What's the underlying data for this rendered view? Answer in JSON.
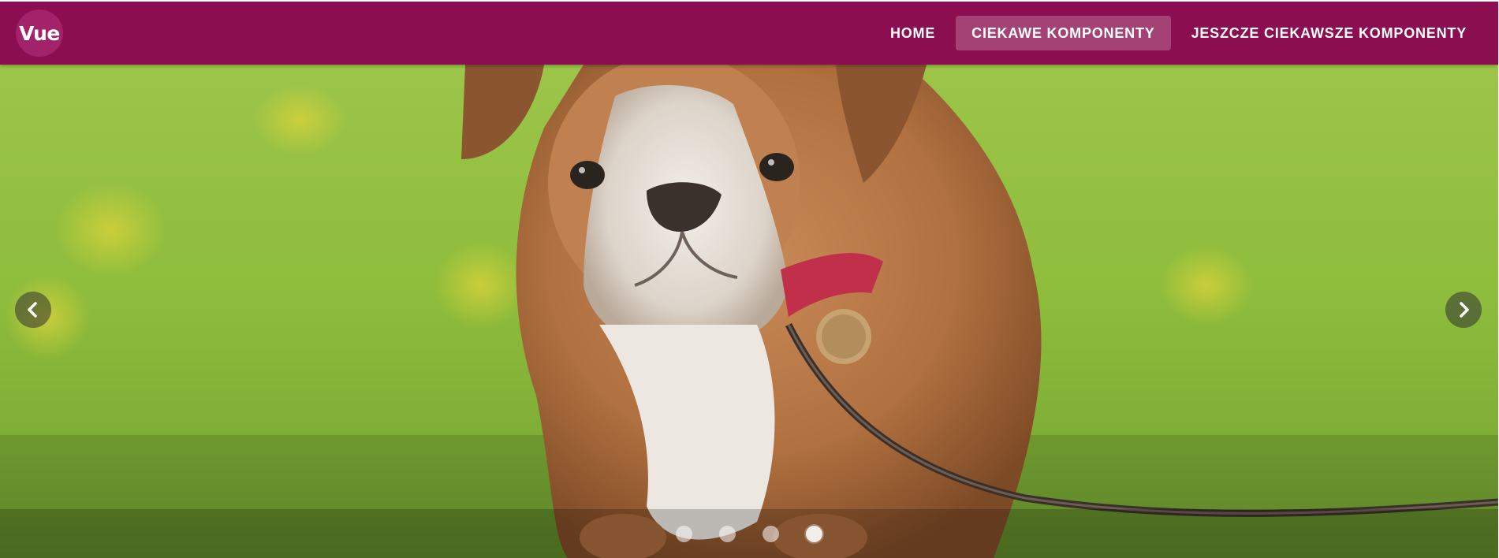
{
  "toolbar": {
    "logo_text": "Vue",
    "background_color": "#8b0e50",
    "nav": [
      {
        "label": "HOME",
        "active": false
      },
      {
        "label": "CIEKAWE KOMPONENTY",
        "active": true
      },
      {
        "label": "JESZCZE CIEKAWSZE KOMPONENTY",
        "active": false
      }
    ]
  },
  "carousel": {
    "slide_subject": "bulldog puppy on a leash in grass",
    "prev_icon": "chevron-left-icon",
    "next_icon": "chevron-right-icon",
    "slide_count": 4,
    "active_index": 3
  }
}
